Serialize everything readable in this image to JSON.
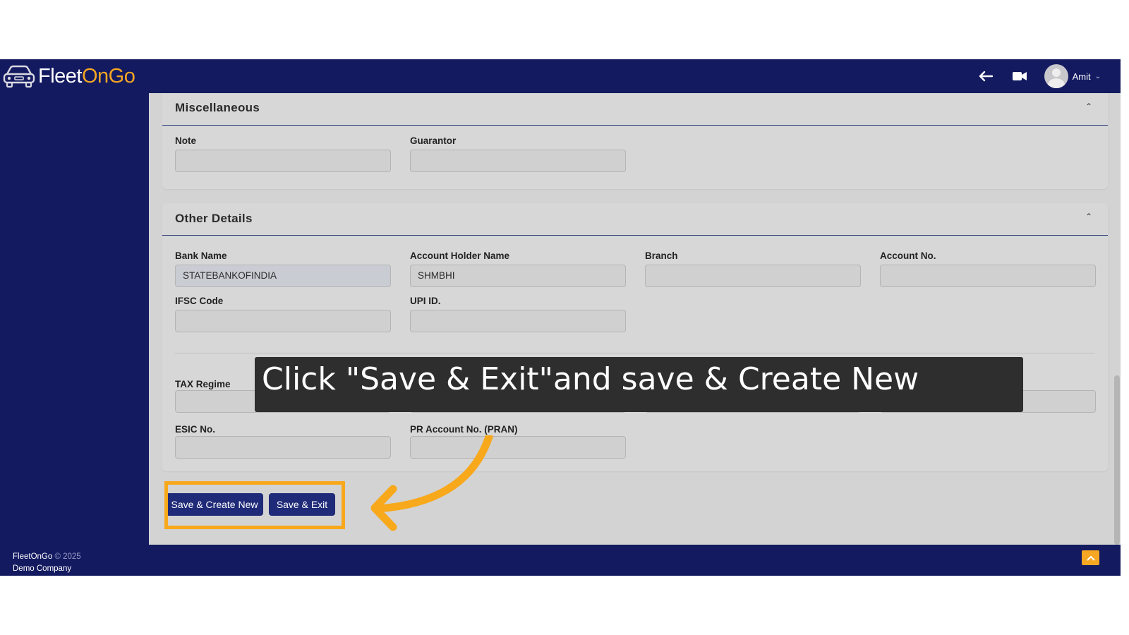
{
  "brand": {
    "logo_white": "Fleet",
    "logo_orange_1": "On",
    "logo_white_2": "G",
    "logo_orange_2": "o"
  },
  "topbar": {
    "user_name": "Amit"
  },
  "sections": {
    "misc": {
      "title": "Miscellaneous",
      "note_label": "Note",
      "note_value": "",
      "guarantor_label": "Guarantor",
      "guarantor_value": ""
    },
    "other": {
      "title": "Other Details",
      "bank_name_label": "Bank Name",
      "bank_name_value": "STATEBANKOFINDIA",
      "account_holder_label": "Account Holder Name",
      "account_holder_value": "SHMBHI",
      "branch_label": "Branch",
      "branch_value": "",
      "account_no_label": "Account No.",
      "account_no_value": "",
      "ifsc_label": "IFSC Code",
      "ifsc_value": "",
      "upi_label": "UPI ID.",
      "upi_value": "",
      "tax_regime_label": "TAX Regime",
      "esic_label": "ESIC No.",
      "esic_value": "",
      "pran_label": "PR Account No. (PRAN)",
      "pran_value": ""
    }
  },
  "actions": {
    "save_create_new": "Save & Create New",
    "save_exit": "Save & Exit"
  },
  "tutorial": {
    "tooltip_text": "Click \"Save & Exit\"and save & Create New",
    "highlight_color": "#f7a81b"
  },
  "footer": {
    "brand": "FleetOnGo",
    "copyright": "© 2025",
    "company": "Demo Company"
  },
  "colors": {
    "nav": "#131a60",
    "accent": "#f5a623",
    "button": "#1f2a78"
  }
}
